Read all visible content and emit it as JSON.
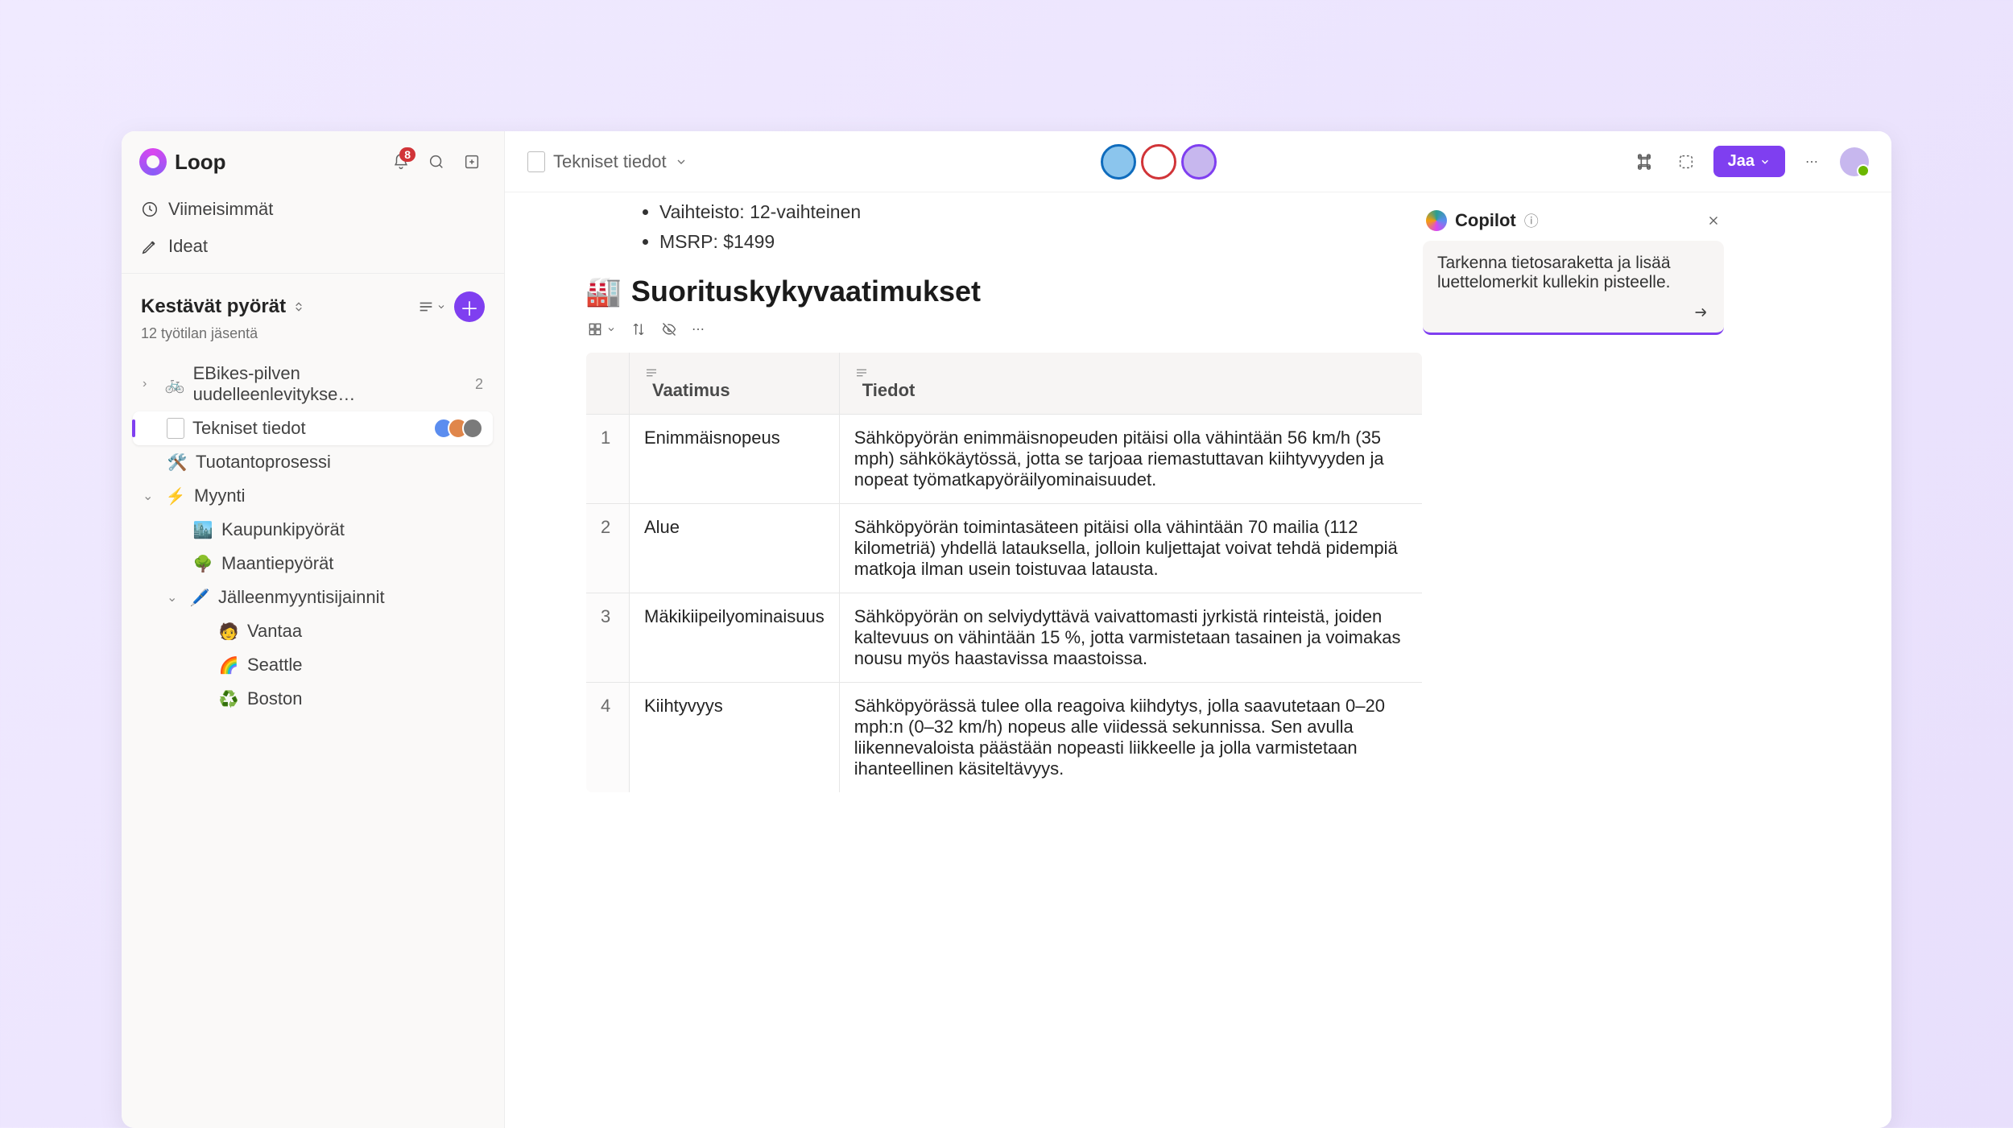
{
  "brand": {
    "name": "Loop"
  },
  "notifications": {
    "count": "8"
  },
  "nav": {
    "recent": "Viimeisimmät",
    "ideas": "Ideat"
  },
  "workspace": {
    "title": "Kestävät pyörät",
    "members": "12 työtilan jäsentä"
  },
  "tree": {
    "ebikes": {
      "label": "EBikes-pilven uudelleenlevitykse…",
      "count": "2"
    },
    "tech": "Tekniset tiedot",
    "production": "Tuotantoprosessi",
    "sales": "Myynti",
    "cityBikes": "Kaupunkipyörät",
    "roadBikes": "Maantiepyörät",
    "resale": "Jälleenmyyntisijainnit",
    "vantaa": "Vantaa",
    "seattle": "Seattle",
    "boston": "Boston"
  },
  "toolbar": {
    "crumb": "Tekniset tiedot",
    "share": "Jaa"
  },
  "doc": {
    "bullet1": "Vaihteisto: 12-vaihteinen",
    "bullet2": "MSRP: $1499",
    "heading": "Suorituskykyvaatimukset",
    "columns": {
      "req": "Vaatimus",
      "details": "Tiedot"
    },
    "rows": [
      {
        "n": "1",
        "req": "Enimmäisnopeus",
        "det": "Sähköpyörän enimmäisnopeuden pitäisi olla vähintään 56 km/h (35 mph) sähkökäytössä, jotta se tarjoaa riemastuttavan kiihtyvyyden ja nopeat työmatkapyöräilyominaisuudet."
      },
      {
        "n": "2",
        "req": "Alue",
        "det": "Sähköpyörän toimintasäteen pitäisi olla vähintään 70 mailia (112 kilometriä) yhdellä latauksella, jolloin kuljettajat voivat tehdä pidempiä matkoja ilman usein toistuvaa latausta."
      },
      {
        "n": "3",
        "req": "Mäkikiipeilyominaisuus",
        "det": "Sähköpyörän on selviydyttävä vaivattomasti jyrkistä rinteistä, joiden kaltevuus on vähintään 15 %, jotta varmistetaan tasainen ja voimakas nousu myös haastavissa maastoissa."
      },
      {
        "n": "4",
        "req": "Kiihtyvyys",
        "det": "Sähköpyörässä tulee olla reagoiva kiihdytys, jolla saavutetaan 0–20 mph:n (0–32 km/h) nopeus alle viidessä sekunnissa. Sen avulla liikennevaloista päästään nopeasti liikkeelle ja jolla varmistetaan ihanteellinen käsiteltävyys."
      }
    ]
  },
  "copilot": {
    "title": "Copilot",
    "prompt": "Tarkenna tietosaraketta ja lisää luettelomerkit kullekin pisteelle."
  }
}
